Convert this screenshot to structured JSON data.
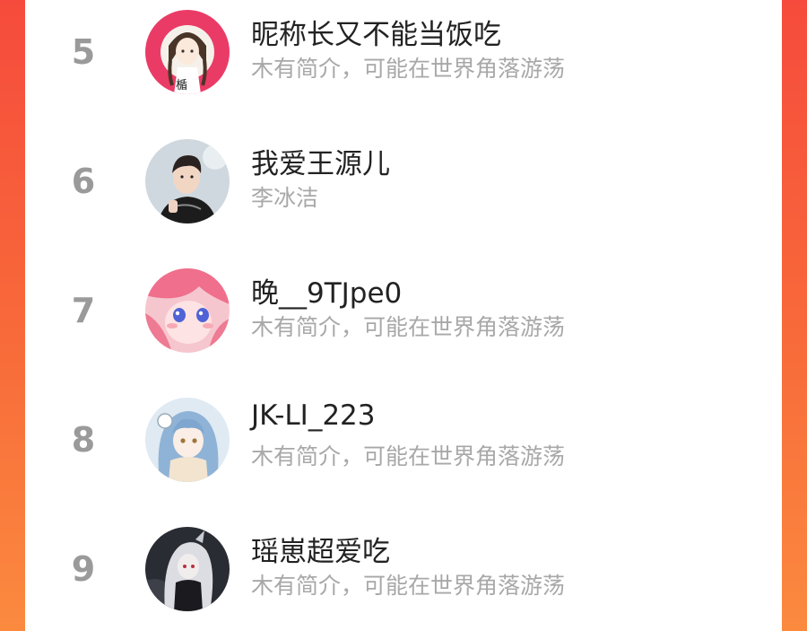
{
  "ranking": [
    {
      "rank": "5",
      "name": "昵称长又不能当饭吃",
      "bio": "木有简介，可能在世界角落游荡",
      "avatar_icon": "pink-girl-avatar-icon",
      "avatar_text": "楯"
    },
    {
      "rank": "6",
      "name": "我爱王源儿",
      "bio": "李冰洁",
      "avatar_icon": "boy-photo-avatar-icon"
    },
    {
      "rank": "7",
      "name": "晚__9TJpe0",
      "bio": "木有简介，可能在世界角落游荡",
      "avatar_icon": "pink-anime-avatar-icon"
    },
    {
      "rank": "8",
      "name": "JK-LI_223",
      "bio": "木有简介，可能在世界角落游荡",
      "avatar_icon": "blue-haired-anime-avatar-icon"
    },
    {
      "rank": "9",
      "name": "瑶崽超爱吃",
      "bio": "木有简介，可能在世界角落游荡",
      "avatar_icon": "dark-white-haired-anime-avatar-icon"
    }
  ],
  "colors": {
    "background_top": "#f64b3c",
    "background_bottom": "#fb8a3f",
    "rank_gray": "#9a9a9a",
    "name_text": "#222222",
    "bio_text": "#a8a8a8"
  }
}
